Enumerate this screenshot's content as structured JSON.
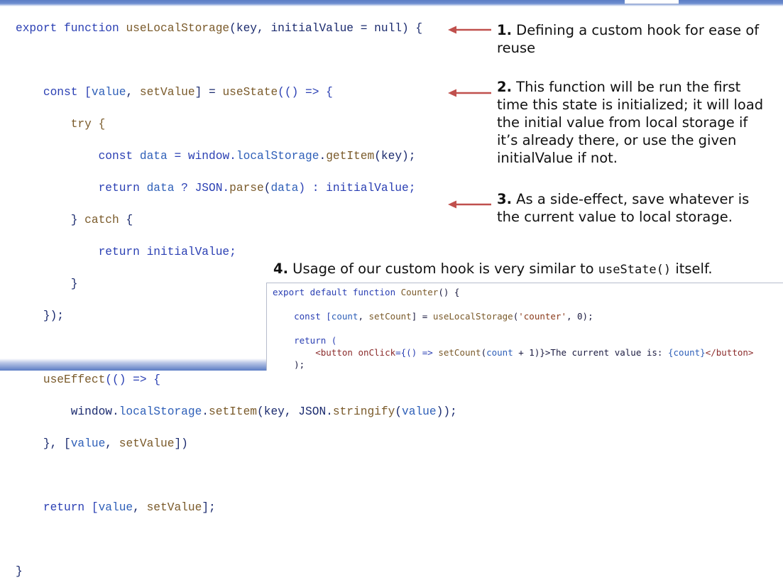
{
  "code": {
    "l1": {
      "a": "export function ",
      "b": "useLocalStorage",
      "c": "(key, initialValue = null) {"
    },
    "l2": {
      "a": "const [",
      "b": "value",
      "c": ", ",
      "d": "setValue",
      "e": "] = ",
      "f": "useState",
      "g": "(() => {"
    },
    "l3": {
      "a": "try {"
    },
    "l4": {
      "a": "const ",
      "b": "data",
      "c": " = window.",
      "d": "localStorage",
      "e": ".",
      "f": "getItem",
      "g": "(key);"
    },
    "l5": {
      "a": "return ",
      "b": "data",
      "c": " ? JSON.",
      "d": "parse",
      "e": "(",
      "f": "data",
      "g": ") : initialValue;"
    },
    "l6": {
      "a": "} ",
      "b": "catch",
      "c": " {"
    },
    "l7": {
      "a": "return ",
      "b": "initialValue;"
    },
    "l8": {
      "a": "}"
    },
    "l9": {
      "a": "});"
    },
    "l10": {
      "a": "useEffect",
      "b": "(() => {"
    },
    "l11": {
      "a": "window.",
      "b": "localStorage",
      "c": ".",
      "d": "setItem",
      "e": "(key, JSON.",
      "f": "stringify",
      "g": "(",
      "h": "value",
      "i": "));"
    },
    "l12": {
      "a": "}, [",
      "b": "value",
      "c": ", ",
      "d": "setValue",
      "e": "])"
    },
    "l13": {
      "a": "return [",
      "b": "value",
      "c": ", ",
      "d": "setValue",
      "e": "];"
    },
    "l14": {
      "a": "}"
    }
  },
  "notes": {
    "n1": {
      "num": "1.",
      "text": " Defining a custom hook for ease of reuse"
    },
    "n2": {
      "num": "2.",
      "text": " This function will be run the first time this state is initialized; it will load the initial value from local storage if it’s already there, or use the given initialValue if not."
    },
    "n3": {
      "num": "3.",
      "text": " As a side-effect, save whatever is the current value to local storage."
    },
    "n4": {
      "num": "4.",
      "text": " Usage of our custom hook is very similar to ",
      "code": "useState()",
      "tail": " itself."
    }
  },
  "example": {
    "e1": {
      "a": "export default function ",
      "b": "Counter",
      "c": "() {"
    },
    "e2": {
      "a": "const [",
      "b": "count",
      "c": ", ",
      "d": "setCount",
      "e": "] = ",
      "f": "useLocalStorage",
      "g": "(",
      "h": "'counter'",
      "i": ", 0);"
    },
    "e3": {
      "a": "return ("
    },
    "e4": {
      "a": "<button ",
      "b": "onClick",
      "c": "={() => ",
      "d": "setCount",
      "e": "(",
      "f": "count",
      "g": " + 1)}>",
      "h": "The current value is: ",
      "i": "{count}",
      "j": "</button>"
    },
    "e5": {
      "a": ");"
    }
  },
  "colors": {
    "arrow": "#c0504d",
    "keyword": "#2a3fb3",
    "function": "#7a5a2a",
    "variable": "#2e5fb8"
  }
}
